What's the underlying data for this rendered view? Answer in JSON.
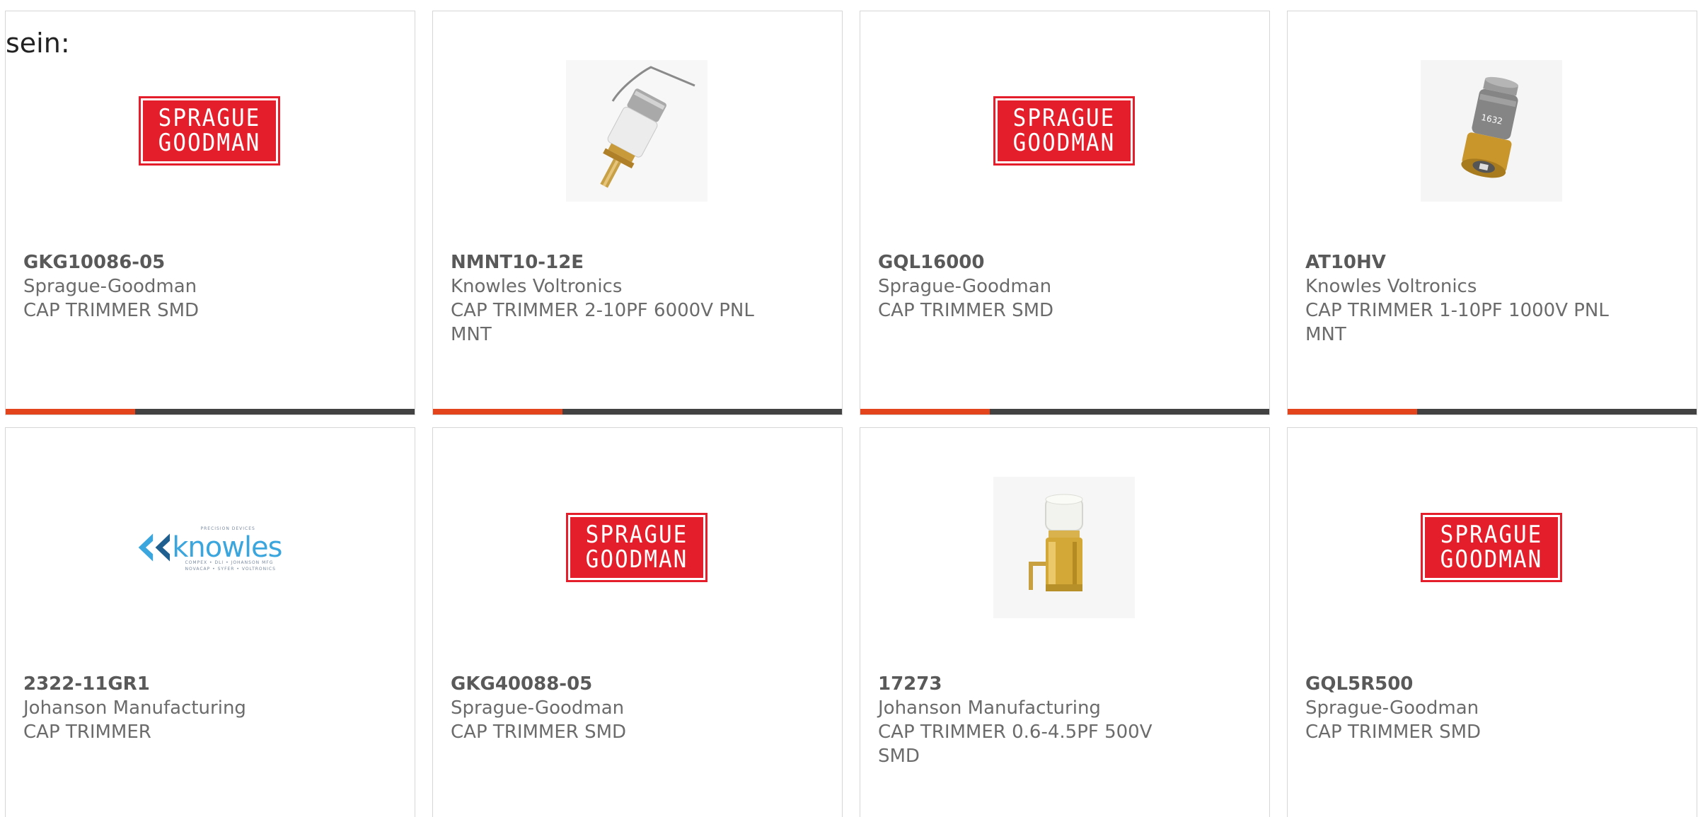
{
  "intro_text": "sein:",
  "logos": {
    "sprague_line1": "SPRAGUE",
    "sprague_line2": "GOODMAN",
    "knowles_word": "knowles",
    "knowles_tag_top": "PRECISION DEVICES",
    "knowles_tag_line1": "COMPEX • DLI • JOHANSON MFG",
    "knowles_tag_line2": "NOVACAP • SYFER • VOLTRONICS"
  },
  "colors": {
    "accent": "#e4441c",
    "bar": "#424242",
    "sprague_red": "#e41f2b",
    "knowles_blue": "#3aa6dd"
  },
  "products": [
    {
      "part_number": "GKG10086-05",
      "manufacturer": "Sprague-Goodman",
      "description": "CAP TRIMMER SMD",
      "image": "sprague-goodman-logo"
    },
    {
      "part_number": "NMNT10-12E",
      "manufacturer": "Knowles Voltronics",
      "description": "CAP TRIMMER 2-10PF 6000V PNL MNT",
      "image": "trimmer-capacitor-wire-lead-photo"
    },
    {
      "part_number": "GQL16000",
      "manufacturer": "Sprague-Goodman",
      "description": "CAP TRIMMER SMD",
      "image": "sprague-goodman-logo"
    },
    {
      "part_number": "AT10HV",
      "manufacturer": "Knowles Voltronics",
      "description": "CAP TRIMMER 1-10PF 1000V PNL MNT",
      "image": "trimmer-capacitor-photo"
    },
    {
      "part_number": "2322-11GR1",
      "manufacturer": "Johanson Manufacturing",
      "description": "CAP TRIMMER",
      "image": "knowles-logo"
    },
    {
      "part_number": "GKG40088-05",
      "manufacturer": "Sprague-Goodman",
      "description": "CAP TRIMMER SMD",
      "image": "sprague-goodman-logo"
    },
    {
      "part_number": "17273",
      "manufacturer": "Johanson Manufacturing",
      "description": "CAP TRIMMER 0.6-4.5PF 500V SMD",
      "image": "smd-trimmer-photo"
    },
    {
      "part_number": "GQL5R500",
      "manufacturer": "Sprague-Goodman",
      "description": "CAP TRIMMER SMD",
      "image": "sprague-goodman-logo"
    }
  ]
}
